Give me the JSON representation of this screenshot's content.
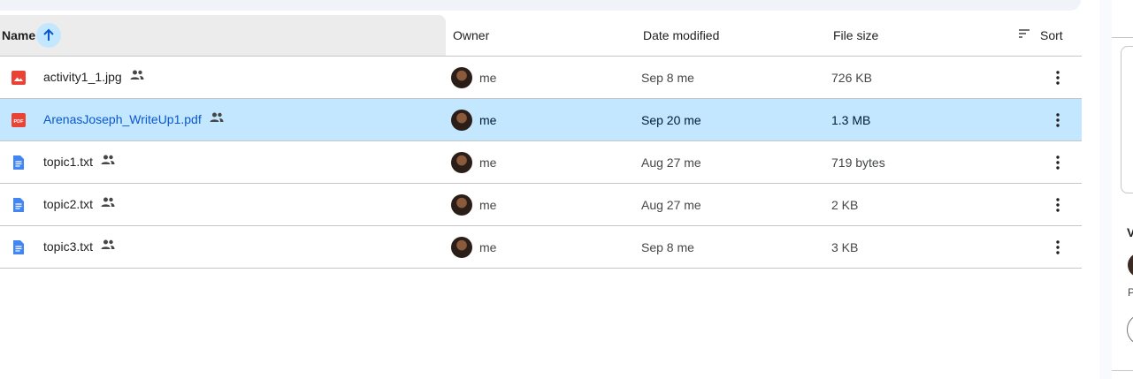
{
  "columns": {
    "name": "Name",
    "owner": "Owner",
    "date_modified": "Date modified",
    "file_size": "File size",
    "sort": "Sort"
  },
  "sort_icon": "arrow-up-icon",
  "files": [
    {
      "name": "activity1_1.jpg",
      "type": "image",
      "owner": "me",
      "date": "Sep 8 me",
      "size": "726 KB",
      "shared": true,
      "selected": false
    },
    {
      "name": "ArenasJoseph_WriteUp1.pdf",
      "type": "pdf",
      "owner": "me",
      "date": "Sep 20 me",
      "size": "1.3 MB",
      "shared": true,
      "selected": true
    },
    {
      "name": "topic1.txt",
      "type": "doc",
      "owner": "me",
      "date": "Aug 27 me",
      "size": "719 bytes",
      "shared": true,
      "selected": false
    },
    {
      "name": "topic2.txt",
      "type": "doc",
      "owner": "me",
      "date": "Aug 27 me",
      "size": "2 KB",
      "shared": true,
      "selected": false
    },
    {
      "name": "topic3.txt",
      "type": "doc",
      "owner": "me",
      "date": "Sep 8 me",
      "size": "3 KB",
      "shared": true,
      "selected": false
    }
  ],
  "right_panel": {
    "letter": "V",
    "small_text": "P"
  },
  "colors": {
    "selected_row": "#c2e7ff",
    "image_icon": "#ea4335",
    "pdf_icon": "#ea4335",
    "doc_icon": "#4285f4"
  }
}
